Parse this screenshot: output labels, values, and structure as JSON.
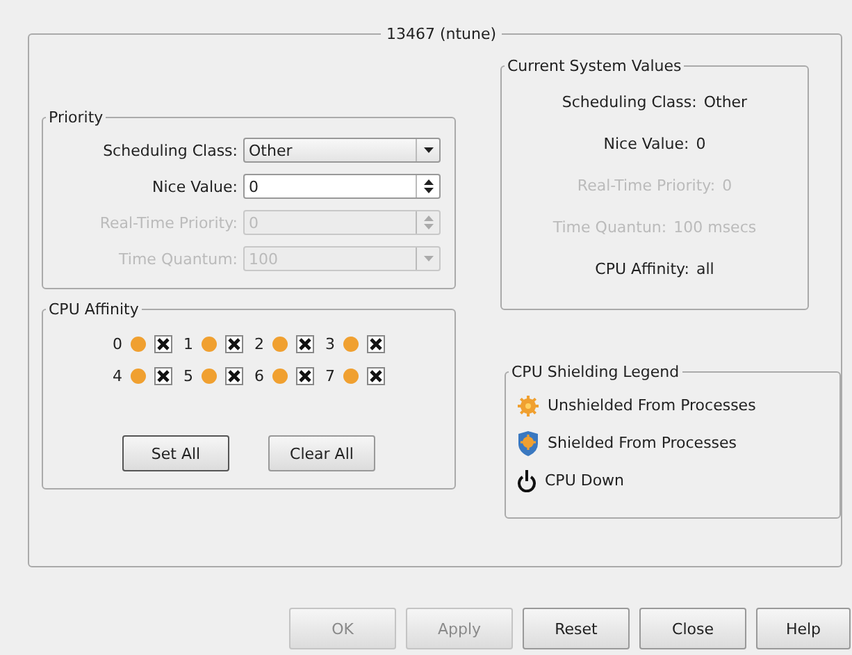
{
  "window": {
    "title": "13467 (ntune)"
  },
  "priority": {
    "title": "Priority",
    "rows": [
      {
        "label": "Scheduling Class:",
        "kind": "dropdown",
        "value": "Other",
        "disabled": false
      },
      {
        "label": "Nice Value:",
        "kind": "spinbox",
        "value": "0",
        "disabled": false
      },
      {
        "label": "Real-Time Priority:",
        "kind": "spinbox",
        "value": "0",
        "disabled": true
      },
      {
        "label": "Time Quantum:",
        "kind": "dropdown",
        "value": "100",
        "disabled": true
      }
    ]
  },
  "cpu_affinity": {
    "title": "CPU Affinity",
    "cpus": [
      {
        "label": "0",
        "shielded": false,
        "checked": true
      },
      {
        "label": "1",
        "shielded": false,
        "checked": true
      },
      {
        "label": "2",
        "shielded": false,
        "checked": true
      },
      {
        "label": "3",
        "shielded": false,
        "checked": true
      },
      {
        "label": "4",
        "shielded": false,
        "checked": true
      },
      {
        "label": "5",
        "shielded": false,
        "checked": true
      },
      {
        "label": "6",
        "shielded": false,
        "checked": true
      },
      {
        "label": "7",
        "shielded": false,
        "checked": true
      }
    ],
    "buttons": [
      "Set All",
      "Clear All"
    ]
  },
  "current_values": {
    "title": "Current System Values",
    "rows": [
      {
        "label": "Scheduling Class:",
        "value": "Other",
        "disabled": false
      },
      {
        "label": "Nice Value:",
        "value": "0",
        "disabled": false
      },
      {
        "label": "Real-Time Priority:",
        "value": "0",
        "disabled": true
      },
      {
        "label": "Time Quantun:",
        "value": "100 msecs",
        "disabled": true
      },
      {
        "label": "CPU Affinity:",
        "value": "all",
        "disabled": false
      }
    ]
  },
  "legend": {
    "title": "CPU Shielding Legend",
    "items": [
      {
        "kind": "unshielded",
        "label": "Unshielded From Processes"
      },
      {
        "kind": "shielded",
        "label": "Shielded From Processes"
      },
      {
        "kind": "down",
        "label": "CPU Down"
      }
    ]
  },
  "buttons": [
    {
      "label": "OK",
      "disabled": true
    },
    {
      "label": "Apply",
      "disabled": true
    },
    {
      "label": "Reset",
      "disabled": false
    },
    {
      "label": "Close",
      "disabled": false
    },
    {
      "label": "Help",
      "disabled": false
    }
  ]
}
